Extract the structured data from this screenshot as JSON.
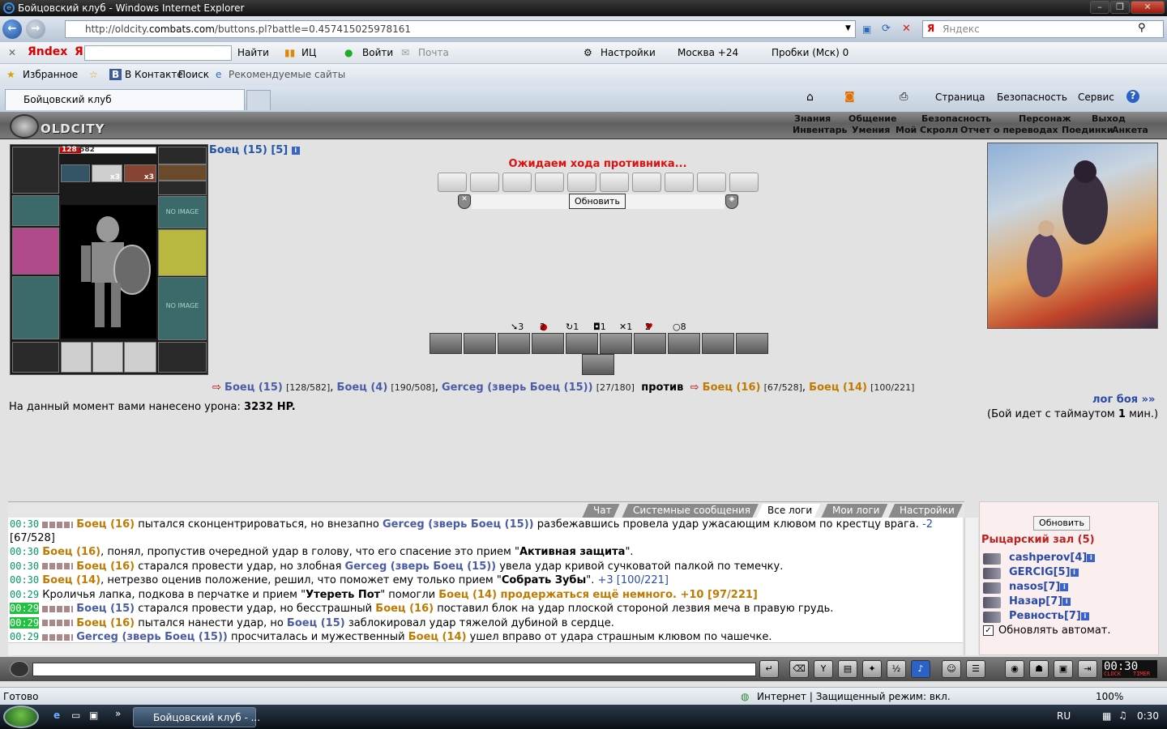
{
  "window": {
    "title": "Бойцовский клуб - Windows Internet Explorer"
  },
  "address": {
    "url_prefix": "http://oldcity.",
    "url_domain": "combats.com",
    "url_rest": "/buttons.pl?battle=0.457415025978161",
    "search_placeholder": "Яндекс"
  },
  "yandex_toolbar": {
    "logo": "Яndex",
    "ya": "Я",
    "find": "Найти",
    "ic": "ИЦ",
    "login": "Войти",
    "mail": "Почта",
    "settings": "Настройки",
    "weather": "Москва +24",
    "traffic": "Пробки (Мск) 0"
  },
  "favbar": {
    "favorites": "Избранное",
    "vkontakte": "В Контакте",
    "search": "Поиск",
    "recommended": "Рекомендуемые сайты"
  },
  "tab": {
    "title": "Бойцовский клуб"
  },
  "ie_cmd": {
    "page": "Страница",
    "security": "Безопасность",
    "service": "Сервис"
  },
  "game": {
    "logo": "OLDCITY",
    "menu_top": [
      "Знания",
      "Общение",
      "Безопасность",
      "Персонаж",
      "Выход"
    ],
    "menu_bottom": [
      "Инвентарь",
      "Умения",
      "Мой Скролл",
      "Отчет о переводах",
      "Поединки",
      "Анкета"
    ],
    "doll": {
      "hp_current": "128",
      "hp_max": "582",
      "hp_fraction": 0.22,
      "no_image": "NO IMAGE",
      "x3a": "x3",
      "x3b": "x3"
    },
    "player": {
      "name": "Боец (15) [5]"
    },
    "waiting": "Ожидаем хода противника...",
    "refresh": "Обновить",
    "stats": [
      "3",
      "2",
      "1",
      "1",
      "1",
      "2",
      "8"
    ],
    "versus": {
      "side1": [
        {
          "name": "Боец (15)",
          "hp": "[128/582]"
        },
        {
          "name": "Боец (4)",
          "hp": "[190/508]"
        },
        {
          "name": "Gerceg (зверь Боец (15))",
          "hp": "[27/180]"
        }
      ],
      "vs": "против",
      "side2": [
        {
          "name": "Боец (16)",
          "hp": "[67/528]"
        },
        {
          "name": "Боец (14)",
          "hp": "[100/221]"
        }
      ]
    },
    "damage_text": "На данный момент вами нанесено урона:",
    "damage_value": "3232 HP.",
    "log_link": "лог боя »»",
    "timeout_pre": "(Бой идет с таймаутом",
    "timeout_val": "1",
    "timeout_post": "мин.)"
  },
  "chat": {
    "tabs": [
      "Чат",
      "Системные сообщения",
      "Все логи",
      "Мои логи",
      "Настройки"
    ],
    "lines": [
      {
        "time": "00:30",
        "a": "Боец (16)",
        "t1": " пытался сконцентрироваться, но внезапно ",
        "b": "Gerceg (зверь Боец (15))",
        "t2": " разбежавшись провела удар ужасающим клювом по крестцу врага. ",
        "v": "-2"
      },
      {
        "time": "",
        "a": "",
        "t1": "[67/528]",
        "b": "",
        "t2": "",
        "v": ""
      },
      {
        "time": "00:30",
        "a": "Боец (16)",
        "t1": ", понял, пропустив очередной удар в голову, что его спасение это прием \"",
        "b": "Активная защита",
        "t2": "\".",
        "v": ""
      },
      {
        "time": "00:30",
        "a": "Боец (16)",
        "t1": " старался провести удар, но злобная ",
        "b": "Gerceg (зверь Боец (15))",
        "t2": " увела удар кривой сучковатой палкой по темечку.",
        "v": ""
      },
      {
        "time": "00:30",
        "a": "Боец (14)",
        "t1": ", нетрезво оценив положение, решил, что поможет ему только прием \"",
        "b": "Собрать Зубы",
        "t2": "\". ",
        "v": "+3 [100/221]"
      },
      {
        "time": "00:29",
        "a": "",
        "t1": "Кроличья лапка, подкова в перчатке и прием \"",
        "b": "Утереть Пот",
        "t2": "\" помогли ",
        "v": "Боец (14) продержаться ещё немного. +10 [97/221]"
      },
      {
        "time": "00:29",
        "a": "Боец (15)",
        "t1": " старался провести удар, но бесстрашный ",
        "b": "Боец (16)",
        "t2": " поставил блок на удар плоской стороной лезвия меча в правую грудь.",
        "v": ""
      },
      {
        "time": "00:29",
        "a": "Боец (16)",
        "t1": " пытался нанести удар, но ",
        "b": "Боец (15)",
        "t2": " заблокировал удар тяжелой дубиной в сердце.",
        "v": ""
      },
      {
        "time": "00:29",
        "a": "Gerceg (зверь Боец (15))",
        "t1": " просчиталась и мужественный ",
        "b": "Боец (14)",
        "t2": " ушел вправо от удара страшным клювом по чашечке.",
        "v": ""
      }
    ]
  },
  "room": {
    "refresh": "Обновить",
    "title": "Рыцарский зал (5)",
    "members": [
      "cashperov[4]",
      "GERCIG[5]",
      "nasos[7]",
      "Назар[7]",
      "Ревность[7]"
    ],
    "auto_refresh": "Обновлять автомат."
  },
  "clock": {
    "time": "00:30",
    "clock_label": "CLOCK",
    "timer_label": "TIMER"
  },
  "status": {
    "ready": "Готово",
    "zone": "Интернет | Защищенный режим: вкл.",
    "zoom": "100%"
  },
  "taskbar": {
    "task": "Бойцовский клуб - ...",
    "lang": "RU",
    "time": "0:30"
  }
}
